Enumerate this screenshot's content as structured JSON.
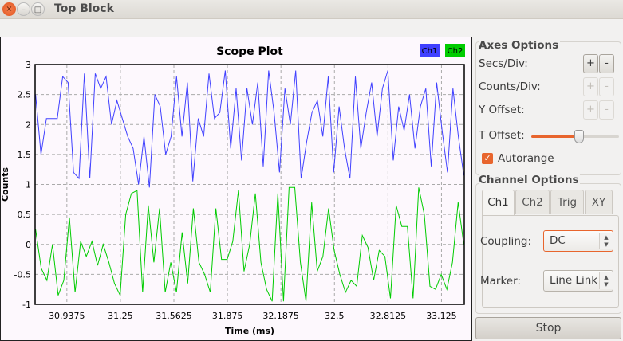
{
  "window": {
    "title": "Top Block",
    "close_icon": "×",
    "minimize_icon": "–",
    "maximize_icon": "□"
  },
  "chart_data": {
    "type": "line",
    "title": "Scope Plot",
    "xlabel": "Time (ms)",
    "ylabel": "Counts",
    "xlim": [
      30.752,
      33.258
    ],
    "ylim": [
      -1,
      3
    ],
    "x_ticks": [
      "30.9375",
      "31.25",
      "31.5625",
      "31.875",
      "32.1875",
      "32.5",
      "32.8125",
      "33.125"
    ],
    "x_tick_values": [
      30.9375,
      31.25,
      31.5625,
      31.875,
      32.1875,
      32.5,
      32.8125,
      33.125
    ],
    "y_ticks": [
      "3",
      "2.5",
      "2",
      "1.5",
      "1",
      "0.5",
      "0",
      "-0.5",
      "-1"
    ],
    "y_tick_values": [
      3,
      2.5,
      2,
      1.5,
      1,
      0.5,
      0,
      -0.5,
      -1
    ],
    "grid": true,
    "legend_position": "top-right",
    "series": [
      {
        "name": "Ch1",
        "color": "#4040ff",
        "t_start": 30.755,
        "t_end": 33.255,
        "values": [
          2.5,
          1.5,
          2.1,
          2.1,
          2.1,
          2.8,
          2.7,
          1.2,
          1.1,
          2.85,
          1.1,
          2.85,
          2.6,
          2.8,
          2.0,
          2.4,
          2.1,
          1.8,
          1.6,
          1.0,
          1.8,
          0.95,
          2.5,
          2.3,
          1.5,
          1.8,
          2.8,
          1.8,
          2.7,
          1.05,
          2.1,
          1.8,
          2.85,
          2.1,
          2.2,
          2.9,
          1.6,
          2.6,
          1.4,
          2.6,
          2.0,
          2.7,
          1.3,
          2.9,
          2.2,
          1.2,
          2.6,
          2.0,
          2.9,
          1.1,
          1.7,
          2.2,
          2.4,
          1.8,
          2.8,
          1.2,
          2.3,
          1.6,
          1.1,
          2.8,
          1.6,
          2.2,
          2.7,
          1.8,
          2.6,
          2.9,
          1.4,
          2.3,
          1.9,
          2.5,
          1.6,
          2.3,
          2.6,
          1.3,
          2.7,
          1.9,
          1.2,
          2.6,
          1.8,
          1.15
        ]
      },
      {
        "name": "Ch2",
        "color": "#00cc00",
        "t_start": 30.755,
        "t_end": 33.255,
        "values": [
          0.25,
          -0.4,
          -0.6,
          0.0,
          -0.85,
          -0.6,
          0.45,
          -0.8,
          0.05,
          -0.2,
          0.05,
          -0.35,
          0.0,
          -0.3,
          -0.65,
          -0.85,
          0.5,
          0.85,
          0.9,
          -0.8,
          0.65,
          -0.3,
          0.6,
          -0.8,
          -0.3,
          -0.8,
          0.2,
          -0.65,
          0.6,
          -0.3,
          -0.5,
          -0.8,
          0.6,
          -0.25,
          -0.25,
          0.05,
          0.9,
          -0.45,
          0.0,
          0.85,
          -0.3,
          -0.75,
          -0.95,
          0.85,
          -0.95,
          0.95,
          0.95,
          -0.3,
          -0.95,
          0.7,
          -0.45,
          -0.2,
          0.6,
          -0.1,
          -0.5,
          -0.8,
          -0.6,
          -0.7,
          0.15,
          -0.05,
          -0.6,
          -0.1,
          -0.2,
          -0.9,
          0.65,
          0.3,
          0.3,
          -0.9,
          0.95,
          0.5,
          -0.7,
          -0.75,
          -0.5,
          -0.75,
          -0.3,
          0.7,
          0.0
        ]
      }
    ]
  },
  "axes_options": {
    "title": "Axes Options",
    "secs_div": "Secs/Div:",
    "counts_div": "Counts/Div:",
    "y_offset": "Y Offset:",
    "t_offset": "T Offset:",
    "t_offset_value": 0.55,
    "plus": "+",
    "minus": "-",
    "autorange": "Autorange",
    "autorange_checked": true
  },
  "channel_options": {
    "title": "Channel Options",
    "tabs": [
      "Ch1",
      "Ch2",
      "Trig",
      "XY"
    ],
    "active_tab": "Ch1",
    "coupling_label": "Coupling:",
    "coupling_value": "DC",
    "marker_label": "Marker:",
    "marker_value": "Line Link"
  },
  "stop_label": "Stop",
  "accent": "#e8652d"
}
